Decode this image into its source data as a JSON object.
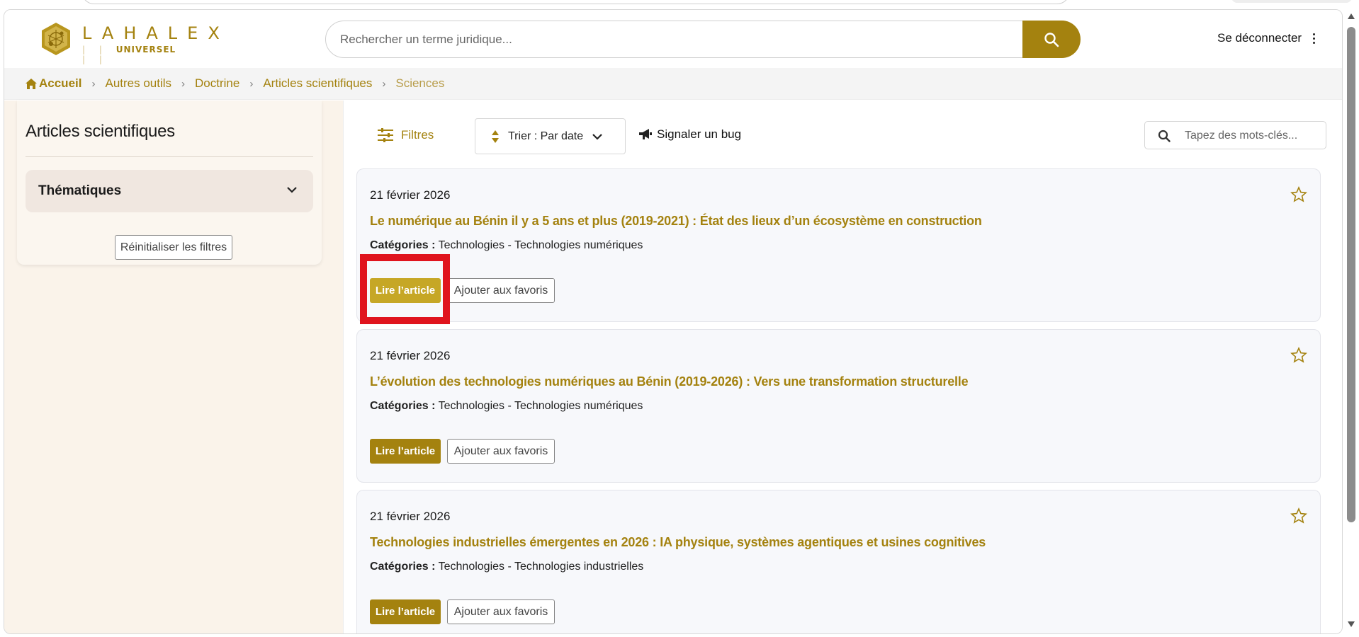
{
  "header": {
    "brand_top": "LAHALEX",
    "brand_bottom": "UNIVERSEL",
    "search_placeholder": "Rechercher un terme juridique...",
    "logout_label": "Se déconnecter"
  },
  "breadcrumb": {
    "items": [
      "Accueil",
      "Autres outils",
      "Doctrine",
      "Articles scientifiques",
      "Sciences"
    ]
  },
  "sidebar": {
    "title": "Articles scientifiques",
    "thematiques_label": "Thématiques",
    "reset_label": "Réinitialiser les filtres"
  },
  "toolbar": {
    "filters_label": "Filtres",
    "sort_label": "Trier : Par date",
    "bug_label": "Signaler un bug",
    "keyword_placeholder": "Tapez des mots-clés..."
  },
  "articles": [
    {
      "date": "21 février 2026",
      "title": "Le numérique au Bénin il y a 5 ans et plus (2019-2021) : État des lieux d’un écosystème en construction",
      "categories_label": "Catégories :",
      "categories": "Technologies - Technologies numériques",
      "read_label": "Lire l’article",
      "fav_label": "Ajouter aux favoris"
    },
    {
      "date": "21 février 2026",
      "title": "L’évolution des technologies numériques au Bénin (2019-2026) : Vers une transformation structurelle",
      "categories_label": "Catégories :",
      "categories": "Technologies - Technologies numériques",
      "read_label": "Lire l’article",
      "fav_label": "Ajouter aux favoris"
    },
    {
      "date": "21 février 2026",
      "title": "Technologies industrielles émergentes en 2026 : IA physique, systèmes agentiques et usines cognitives",
      "categories_label": "Catégories :",
      "categories": "Technologies - Technologies industrielles",
      "read_label": "Lire l’article",
      "fav_label": "Ajouter aux favoris"
    }
  ],
  "colors": {
    "accent": "#a4820f",
    "accent_highlight": "#c6a726",
    "annotation_red": "#e0141e",
    "sidebar_bg": "#faf3ea",
    "card_bg": "#f7f8fb"
  },
  "icons": [
    "logo-emblem",
    "search-icon",
    "home-icon",
    "chevron-right-icon",
    "chevron-down-icon",
    "sliders-icon",
    "sort-icon",
    "megaphone-icon",
    "star-icon",
    "kebab-icon"
  ]
}
